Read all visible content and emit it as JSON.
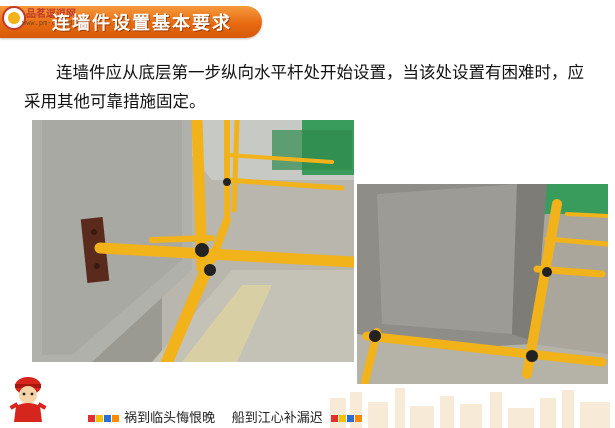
{
  "header": {
    "logo_text": "品茗逗逗网",
    "logo_url": "www.pm-cloud.com",
    "title": "连墙件设置基本要求"
  },
  "content": {
    "paragraph": "连墙件应从底层第一步纵向水平杆处开始设置，当该处设置有困难时，应采用其他可靠措施固定。"
  },
  "footer": {
    "slogan_left": "祸到临头悔恨晚",
    "slogan_right": "船到江心补漏迟"
  },
  "colors": {
    "banner": "#e86a12",
    "scaffold_yellow": "#f2b21a",
    "square_colors": [
      "#e03030",
      "#f2c200",
      "#2a6fd6",
      "#ff8a00"
    ]
  }
}
